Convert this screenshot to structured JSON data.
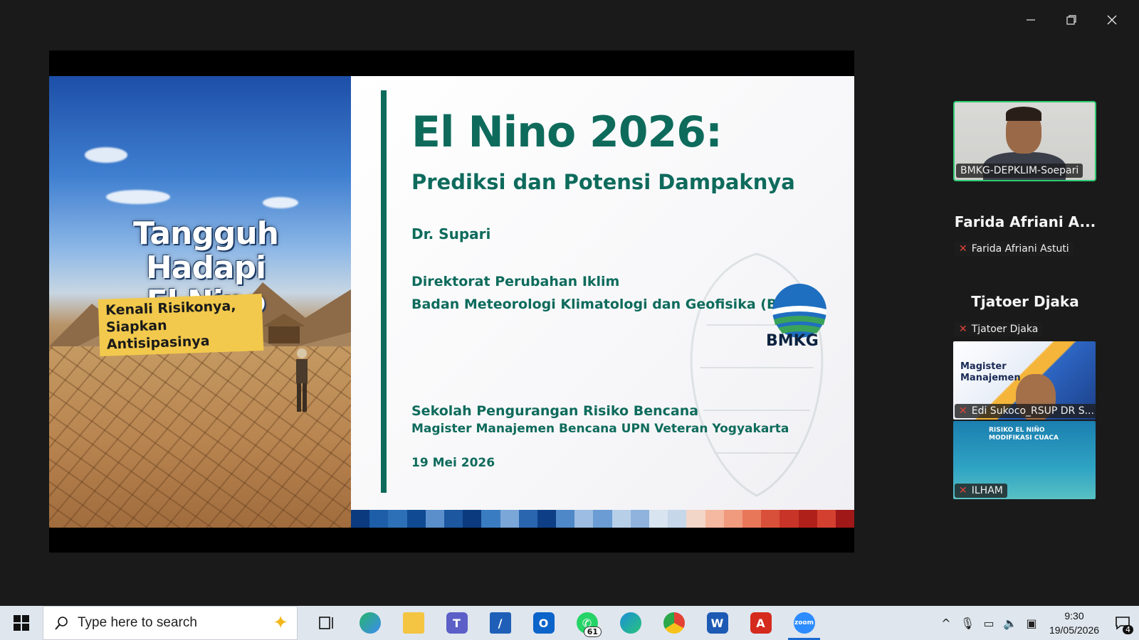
{
  "window": {
    "minimize_icon": "minimize-icon",
    "restore_icon": "restore-icon",
    "close_icon": "close-icon"
  },
  "slide": {
    "poster_title_line1": "Tangguh Hadapi",
    "poster_title_line2": "El Nino",
    "poster_sub_line1": "Kenali Risikonya,",
    "poster_sub_line2": "Siapkan Antisipasinya",
    "title": "El Nino 2026:",
    "subtitle": "Prediksi dan Potensi Dampaknya",
    "author": "Dr. Supari",
    "org_line1": "Direktorat Perubahan Iklim",
    "org_line2": "Badan Meteorologi Klimatologi dan Geofisika (BMKG)",
    "logo_text": "BMKG",
    "school_line1": "Sekolah Pengurangan Risiko Bencana",
    "school_line2": "Magister Manajemen Bencana UPN Veteran Yogyakarta",
    "date": "19 Mei 2026",
    "accent_color": "#0e6b5c"
  },
  "participants": {
    "video_label": "BMKG-DEPKLIM-Soepari",
    "farida_big": "Farida Afriani A...",
    "farida_label": "Farida Afriani Astuti",
    "tjatoer_big": "Tjatoer Djaka",
    "tjatoer_label": "Tjatoer Djaka",
    "edi_label": "Edi Sukoco_RSUP DR S...",
    "edi_tile_text_line1": "Magister",
    "edi_tile_text_line2": "Manajemen",
    "ilham_label": "ILHAM",
    "ilham_tile_text_line1": "RISIKO EL NIÑO",
    "ilham_tile_text_line2": "MODIFIKASI CUACA"
  },
  "taskbar": {
    "search_placeholder": "Type here to search",
    "whatsapp_badge": "61",
    "time": "9:30",
    "date": "19/05/2026",
    "notification_count": "4"
  }
}
